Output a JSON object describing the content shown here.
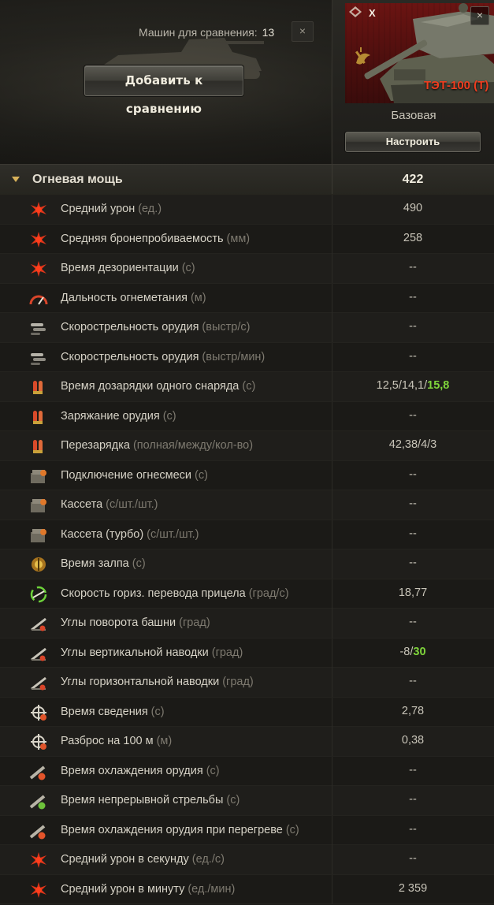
{
  "header": {
    "compare_label": "Машин для сравнения:",
    "compare_count": "13",
    "clear_label": "×",
    "add_button": "Добавить к сравнению"
  },
  "vehicle": {
    "tier": "X",
    "name": "ТЭТ-100 (Т)",
    "close": "×",
    "config": "Базовая",
    "configure_button": "Настроить"
  },
  "section": {
    "title": "Огневая мощь",
    "total": "422"
  },
  "rows": [
    {
      "icon": "avg-damage-icon",
      "label": "Средний урон",
      "unit": "(ед.)",
      "value": "490"
    },
    {
      "icon": "avg-penetration-icon",
      "label": "Средняя бронепробиваемость",
      "unit": "(мм)",
      "value": "258"
    },
    {
      "icon": "stun-duration-icon",
      "label": "Время дезориентации",
      "unit": "(с)",
      "value": "--"
    },
    {
      "icon": "flamethrower-range-icon",
      "label": "Дальность огнеметания",
      "unit": "(м)",
      "value": "--"
    },
    {
      "icon": "rate-of-fire-icon",
      "label": "Скорострельность орудия",
      "unit": "(выстр/с)",
      "value": "--"
    },
    {
      "icon": "rate-of-fire-min-icon",
      "label": "Скорострельность орудия",
      "unit": "(выстр/мин)",
      "value": "--"
    },
    {
      "icon": "shell-reload-icon",
      "label": "Время дозарядки одного снаряда",
      "unit": "(с)",
      "value": "12,5/14,1/",
      "value_hl": "15,8"
    },
    {
      "icon": "gun-loading-icon",
      "label": "Заряжание орудия",
      "unit": "(с)",
      "value": "--"
    },
    {
      "icon": "clip-reload-icon",
      "label": "Перезарядка",
      "unit": "(полная/между/кол-во)",
      "value": "42,38/4/3"
    },
    {
      "icon": "fuel-mix-icon",
      "label": "Подключение огнесмеси",
      "unit": "(с)",
      "value": "--"
    },
    {
      "icon": "cassette-icon",
      "label": "Кассета",
      "unit": "(с/шт./шт.)",
      "value": "--"
    },
    {
      "icon": "cassette-turbo-icon",
      "label": "Кассета (турбо)",
      "unit": "(с/шт./шт.)",
      "value": "--"
    },
    {
      "icon": "salvo-time-icon",
      "label": "Время залпа",
      "unit": "(с)",
      "value": "--"
    },
    {
      "icon": "aim-traverse-icon",
      "label": "Скорость гориз. перевода прицела",
      "unit": "(град/с)",
      "value": "18,77"
    },
    {
      "icon": "turret-rotation-icon",
      "label": "Углы поворота башни",
      "unit": "(град)",
      "value": "--"
    },
    {
      "icon": "elevation-angles-icon",
      "label": "Углы вертикальной наводки",
      "unit": "(град)",
      "value": "-8/",
      "value_hl": "30"
    },
    {
      "icon": "horizontal-angles-icon",
      "label": "Углы горизонтальной наводки",
      "unit": "(град)",
      "value": "--"
    },
    {
      "icon": "aim-time-icon",
      "label": "Время сведения",
      "unit": "(с)",
      "value": "2,78"
    },
    {
      "icon": "dispersion-icon",
      "label": "Разброс на 100 м",
      "unit": "(м)",
      "value": "0,38"
    },
    {
      "icon": "gun-cooling-icon",
      "label": "Время охлаждения орудия",
      "unit": "(с)",
      "value": "--"
    },
    {
      "icon": "continuous-fire-icon",
      "label": "Время непрерывной стрельбы",
      "unit": "(с)",
      "value": "--"
    },
    {
      "icon": "overheat-cooling-icon",
      "label": "Время охлаждения орудия при перегреве",
      "unit": "(с)",
      "value": "--"
    },
    {
      "icon": "dpm-second-icon",
      "label": "Средний урон в секунду",
      "unit": "(ед./с)",
      "value": "--"
    },
    {
      "icon": "dpm-minute-icon",
      "label": "Средний урон в минуту",
      "unit": "(ед./мин)",
      "value": "2 359"
    }
  ]
}
